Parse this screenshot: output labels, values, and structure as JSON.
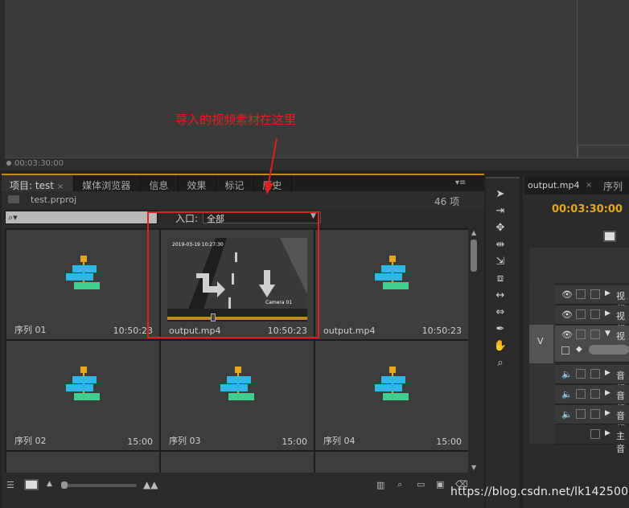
{
  "annotation": "导入的视频素材在这里",
  "monitor": {
    "timecode": "00:03:30:00"
  },
  "project_panel": {
    "tabs": [
      {
        "label": "项目: test",
        "close": "×"
      },
      {
        "label": "媒体浏览器"
      },
      {
        "label": "信息"
      },
      {
        "label": "效果"
      },
      {
        "label": "标记"
      },
      {
        "label": "历史"
      }
    ],
    "menu_icon": "▾≡",
    "project_file": "test.prproj",
    "item_count": "46 项",
    "search_placeholder": "⌕▾",
    "in_label": "入口:",
    "in_value": "全部",
    "items": [
      {
        "name": "序列 01",
        "duration": "10:50:23",
        "kind": "sequence"
      },
      {
        "name": "output.mp4",
        "duration": "10:50:23",
        "kind": "video",
        "selected": true
      },
      {
        "name": "output.mp4",
        "duration": "10:50:23",
        "kind": "sequence"
      },
      {
        "name": "序列 02",
        "duration": "15:00",
        "kind": "sequence"
      },
      {
        "name": "序列 03",
        "duration": "15:00",
        "kind": "sequence"
      },
      {
        "name": "序列 04",
        "duration": "15:00",
        "kind": "sequence"
      }
    ],
    "video_overlay_text": "2019-03-19 10:27:30",
    "video_watermark": "Camera 01"
  },
  "timeline": {
    "tab1": "output.mp4",
    "tab1_close": "×",
    "tab2": "序列",
    "timecode": "00:03:30:00",
    "v_label": "V",
    "tracks": [
      {
        "name": "视频",
        "type": "video"
      },
      {
        "name": "视频",
        "type": "video"
      },
      {
        "name": "视频",
        "type": "video",
        "active": true
      },
      {
        "name": "音频",
        "type": "audio"
      },
      {
        "name": "音频",
        "type": "audio"
      },
      {
        "name": "音频",
        "type": "audio"
      },
      {
        "name": "主音",
        "type": "master"
      }
    ]
  },
  "watermark": "https://blog.csdn.net/lk142500",
  "colors": {
    "accent_orange": "#e8a718",
    "annotation_red": "#e02020",
    "seq_cyan": "#2fb7e6",
    "seq_green": "#3fcf8e"
  }
}
